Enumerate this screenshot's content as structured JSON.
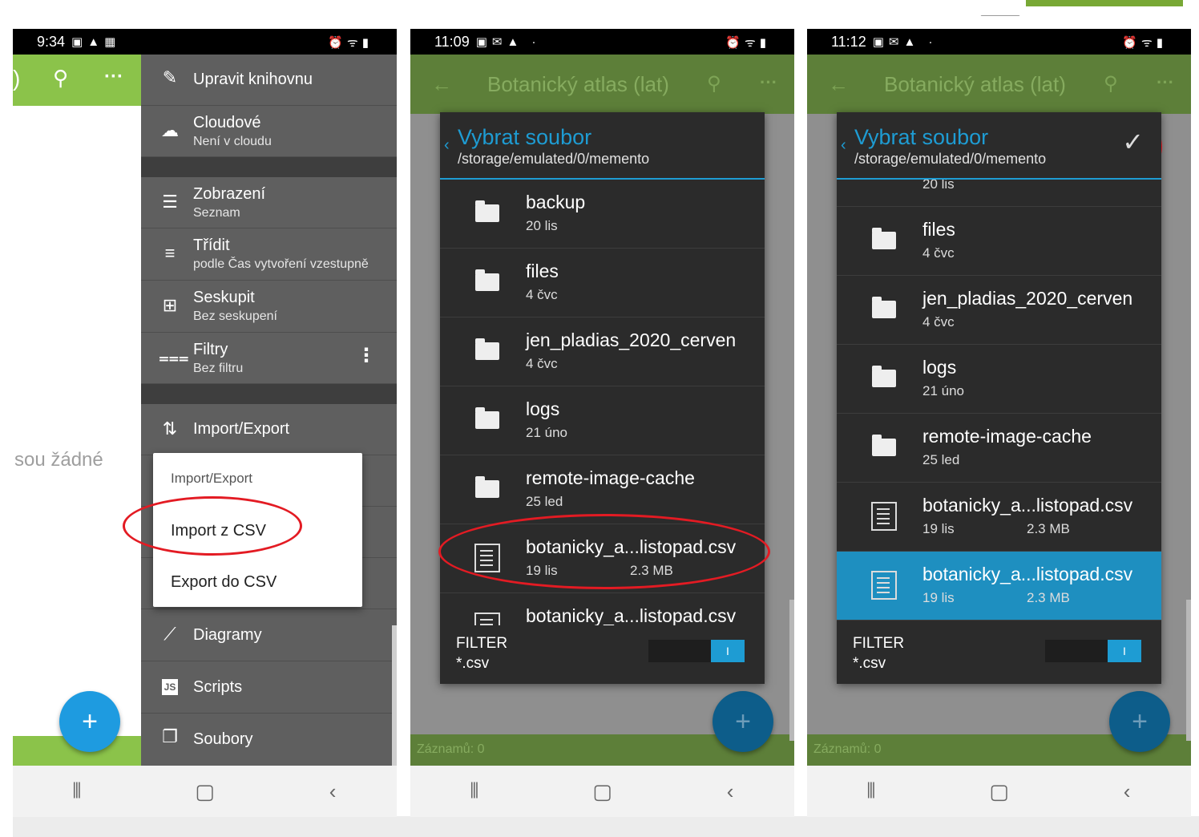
{
  "phone1": {
    "status": {
      "time": "9:34"
    },
    "empty_text": "sou žádné",
    "drawer": {
      "items": [
        {
          "label": "Upravit knihovnu",
          "sub": "",
          "icon": "edit-icon"
        },
        {
          "label": "Cloudové",
          "sub": "Není v cloudu",
          "icon": "cloud-icon"
        },
        {
          "label": "Zobrazení",
          "sub": "Seznam",
          "icon": "list-view-icon"
        },
        {
          "label": "Třídit",
          "sub": "podle Čas vytvoření vzestupně",
          "icon": "sort-icon"
        },
        {
          "label": "Seskupit",
          "sub": "Bez seskupení",
          "icon": "group-icon"
        },
        {
          "label": "Filtry",
          "sub": "Bez filtru",
          "icon": "filter-icon"
        },
        {
          "label": "Import/Export",
          "sub": "",
          "icon": "import-export-icon"
        },
        {
          "label": "Diagramy",
          "sub": "",
          "icon": "chart-icon"
        },
        {
          "label": "Scripts",
          "sub": "",
          "icon": "js-icon"
        },
        {
          "label": "Soubory",
          "sub": "",
          "icon": "files-icon"
        }
      ]
    },
    "popup": {
      "title": "Import/Export",
      "import": "Import z CSV",
      "export": "Export do CSV"
    }
  },
  "phone2": {
    "status": {
      "time": "11:09"
    },
    "app_title": "Botanický atlas (lat)",
    "footer": "Záznamů: 0",
    "dialog": {
      "title": "Vybrat soubor",
      "path": "/storage/emulated/0/memento",
      "files": [
        {
          "name": "backup",
          "date": "20 lis",
          "size": "",
          "type": "folder"
        },
        {
          "name": "files",
          "date": "4 čvc",
          "size": "",
          "type": "folder"
        },
        {
          "name": "jen_pladias_2020_cerven",
          "date": "4 čvc",
          "size": "",
          "type": "folder"
        },
        {
          "name": "logs",
          "date": "21 úno",
          "size": "",
          "type": "folder"
        },
        {
          "name": "remote-image-cache",
          "date": "25 led",
          "size": "",
          "type": "folder"
        },
        {
          "name": "botanicky_a...listopad.csv",
          "date": "19 lis",
          "size": "2.3 MB",
          "type": "file"
        },
        {
          "name": "botanicky_a...listopad.csv",
          "date": "",
          "size": "",
          "type": "file"
        }
      ],
      "filter_label": "FILTER",
      "filter_value": "*.csv",
      "toggle_text": "I"
    }
  },
  "phone3": {
    "status": {
      "time": "11:12"
    },
    "app_title": "Botanický atlas (lat)",
    "footer": "Záznamů: 0",
    "dialog": {
      "title": "Vybrat soubor",
      "path": "/storage/emulated/0/memento",
      "partial_date": "20 lis",
      "files": [
        {
          "name": "files",
          "date": "4 čvc",
          "size": "",
          "type": "folder"
        },
        {
          "name": "jen_pladias_2020_cerven",
          "date": "4 čvc",
          "size": "",
          "type": "folder"
        },
        {
          "name": "logs",
          "date": "21 úno",
          "size": "",
          "type": "folder"
        },
        {
          "name": "remote-image-cache",
          "date": "25 led",
          "size": "",
          "type": "folder"
        },
        {
          "name": "botanicky_a...listopad.csv",
          "date": "19 lis",
          "size": "2.3 MB",
          "type": "file"
        },
        {
          "name": "botanicky_a...listopad.csv",
          "date": "19 lis",
          "size": "2.3 MB",
          "type": "file",
          "selected": true
        }
      ],
      "filter_label": "FILTER",
      "filter_value": "*.csv",
      "toggle_text": "I"
    }
  },
  "colors": {
    "green": "#8bc34a",
    "dim_green": "#5d7f39",
    "accent_blue": "#1e9cd3",
    "highlight_red": "#e31b23"
  }
}
